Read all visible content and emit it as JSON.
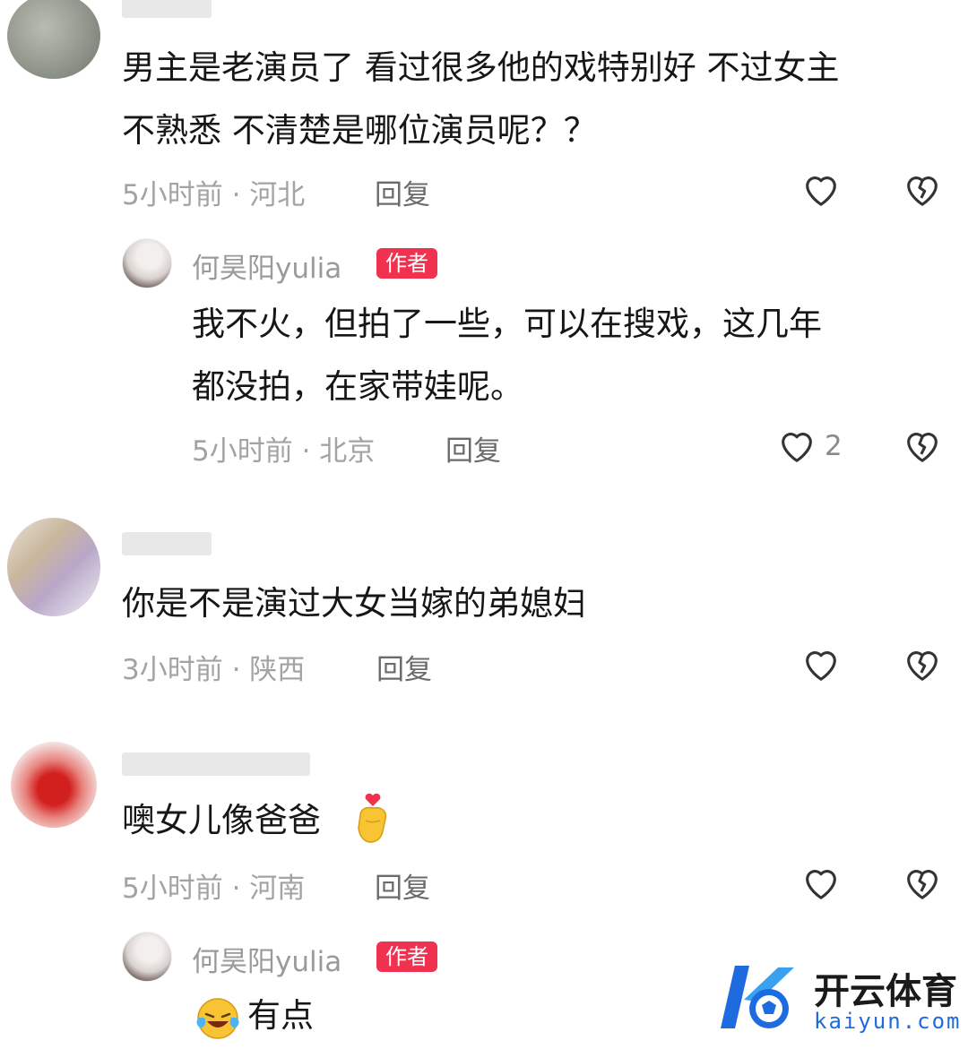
{
  "comments": [
    {
      "text_line1": "男主是老演员了  看过很多他的戏特别好  不过女主",
      "text_line2": "不熟悉 不清楚是哪位演员呢？？",
      "time_loc": "5小时前 · 河北",
      "reply": "回复",
      "reply_item": {
        "author": "何昊阳yulia",
        "badge": "作者",
        "text_line1": "我不火，但拍了一些，可以在搜戏，这几年",
        "text_line2": "都没拍，在家带娃呢。",
        "time_loc": "5小时前 · 北京",
        "reply": "回复",
        "like_count": "2"
      }
    },
    {
      "text_line1": "你是不是演过大女当嫁的弟媳妇",
      "time_loc": "3小时前 · 陕西",
      "reply": "回复"
    },
    {
      "text_line1": "噢女儿像爸爸",
      "time_loc": "5小时前 · 河南",
      "reply": "回复",
      "reply_item": {
        "author": "何昊阳yulia",
        "badge": "作者",
        "text_line1": "有点"
      }
    }
  ],
  "watermark": {
    "title": "开云体育",
    "subtitle": "kaiyun.com"
  },
  "colors": {
    "badge": "#f0314f",
    "meta": "#a3a3a3",
    "watermark_blue": "#1e6be0"
  }
}
